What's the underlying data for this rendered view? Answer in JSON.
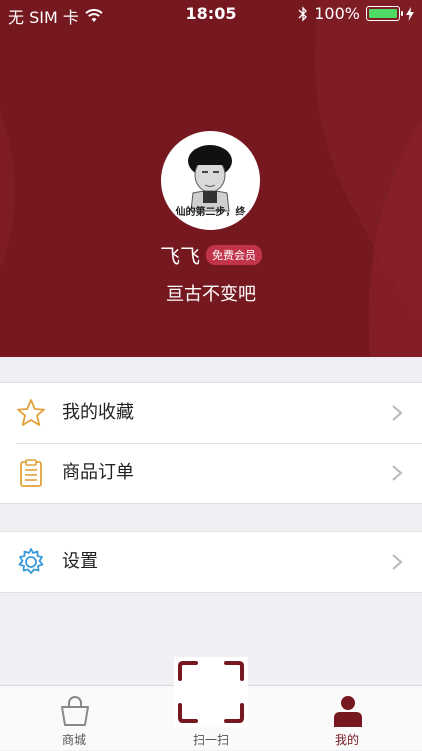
{
  "status_bar": {
    "carrier": "无 SIM 卡",
    "time": "18:05",
    "battery": "100%",
    "battery_level": 1.0
  },
  "profile": {
    "avatar_caption": "仙的第二步，终",
    "username": "飞飞",
    "member_badge": "免费会员",
    "signature": "亘古不变吧"
  },
  "menu": {
    "favorites_label": "我的收藏",
    "orders_label": "商品订单",
    "settings_label": "设置"
  },
  "tabbar": {
    "shop_label": "商城",
    "scan_label": "扫一扫",
    "mine_label": "我的"
  },
  "colors": {
    "brand": "#761820",
    "badge": "#c2344a",
    "star_icon": "#e2a13b",
    "settings_icon": "#3a9ad9"
  },
  "icons": [
    "wifi-icon",
    "bluetooth-icon",
    "battery-icon",
    "charging-icon",
    "star-icon",
    "clipboard-icon",
    "gear-icon",
    "chevron-right-icon",
    "bag-icon",
    "scan-icon",
    "user-icon"
  ]
}
